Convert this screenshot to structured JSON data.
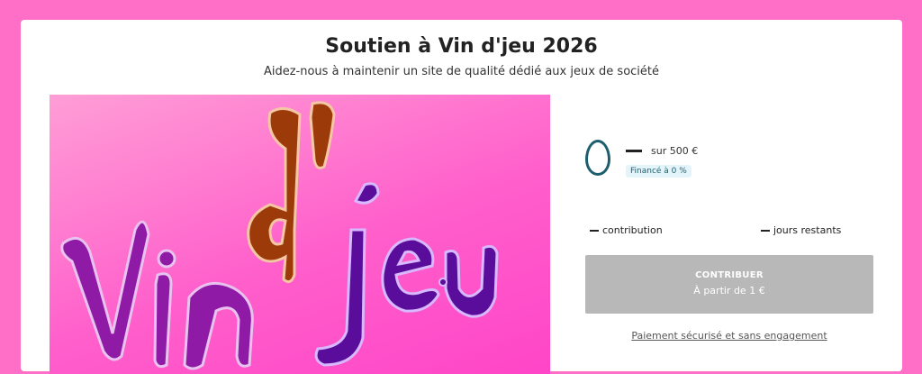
{
  "header": {
    "title": "Soutien à Vin d'jeu 2026",
    "subtitle": "Aidez-nous à maintenir un site de qualité dédié aux jeux de société"
  },
  "funding": {
    "goal_text": "sur 500 €",
    "funded_badge": "Financé à 0 %",
    "funded_percent": 0,
    "contributions_label": "contribution",
    "days_label": "jours restants"
  },
  "cta": {
    "label": "CONTRIBUER",
    "sublabel": "À partir de 1 €"
  },
  "secure_link": "Paiement sécurisé et sans engagement",
  "hero": {
    "logo_text": "Vin d'jeu",
    "colors": {
      "bg_top": "#ff9ed6",
      "bg_bottom": "#ff45c8",
      "v_i_n": "#8e1aa5",
      "d": "#9c3a0a",
      "jeu": "#5a0c9a"
    }
  },
  "colors": {
    "page_bg": "#ff6ec7",
    "accent": "#1d5e6e",
    "button_disabled": "#b8b8b8"
  }
}
